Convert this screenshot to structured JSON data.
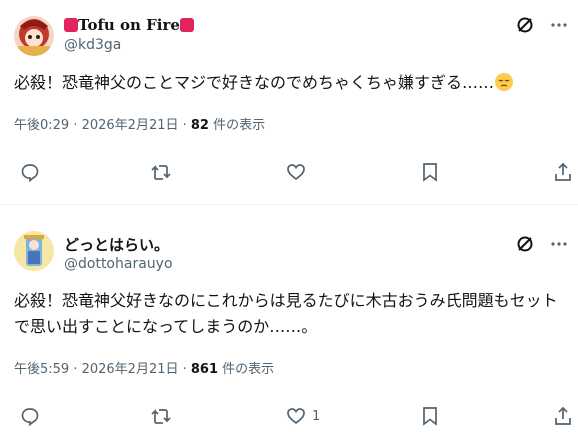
{
  "tweets": [
    {
      "display_name": "Tofu on Fire",
      "handle": "@kd3ga",
      "text": "必殺！恐竜神父のことマジで好きなのでめちゃくちゃ嫌すぎる……",
      "time": "午後0:29 · 2026年2月21日 · ",
      "views": "82",
      "views_suffix": " 件の表示",
      "like_count": ""
    },
    {
      "display_name": "どっとはらい。",
      "handle": "@dottoharauyo",
      "text": "必殺！恐竜神父好きなのにこれからは見るたびに木古おうみ氏問題もセットで思い出すことになってしまうのか……。",
      "time": "午後5:59 · 2026年2月21日 · ",
      "views": "861",
      "views_suffix": " 件の表示",
      "like_count": "1"
    }
  ],
  "icons": [
    "grok-icon",
    "more-icon",
    "reply-icon",
    "retweet-icon",
    "like-icon",
    "bookmark-icon",
    "share-icon",
    "pensive-emoji-icon"
  ],
  "colors": {
    "text": "#0f1419",
    "secondary": "#536471",
    "divider": "#eff3f4"
  }
}
